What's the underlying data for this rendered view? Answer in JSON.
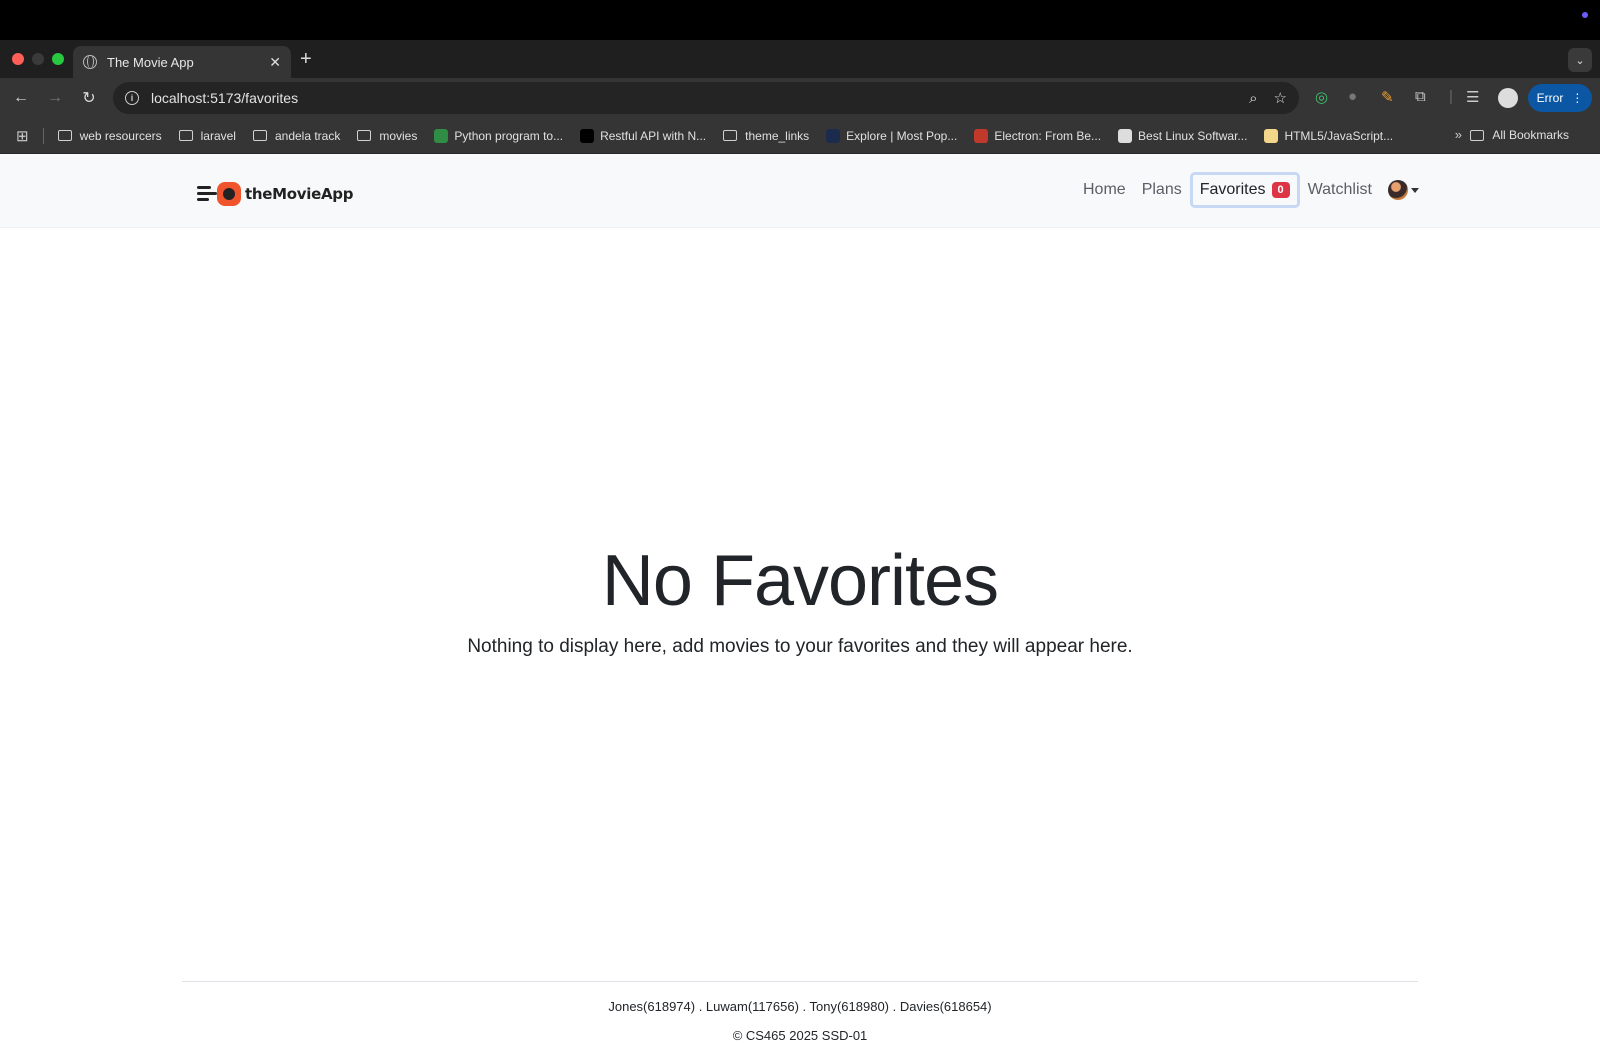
{
  "browser": {
    "tab_title": "The Movie App",
    "new_tab": "+",
    "url": "localhost:5173/favorites",
    "error_label": "Error",
    "bookmarks": [
      {
        "label": "web resourcers",
        "kind": "folder"
      },
      {
        "label": "laravel",
        "kind": "folder"
      },
      {
        "label": "andela track",
        "kind": "folder"
      },
      {
        "label": "movies",
        "kind": "folder"
      },
      {
        "label": "Python program to...",
        "kind": "site",
        "color": "#2f8d46"
      },
      {
        "label": "Restful API with N...",
        "kind": "site",
        "color": "#000000"
      },
      {
        "label": "theme_links",
        "kind": "folder"
      },
      {
        "label": "Explore | Most Pop...",
        "kind": "site",
        "color": "#1a2b4c"
      },
      {
        "label": "Electron: From Be...",
        "kind": "site",
        "color": "#c0392b"
      },
      {
        "label": "Best Linux Softwar...",
        "kind": "site",
        "color": "#dddddd"
      },
      {
        "label": "HTML5/JavaScript...",
        "kind": "site",
        "color": "#f2d78a"
      }
    ],
    "all_bookmarks": "All Bookmarks"
  },
  "app": {
    "logo_text": "theMovieApp",
    "nav": {
      "home": "Home",
      "plans": "Plans",
      "favorites": "Favorites",
      "favorites_count": "0",
      "watchlist": "Watchlist"
    },
    "accent_color": "#dc3545"
  },
  "main": {
    "heading": "No Favorites",
    "lead": "Nothing to display here, add movies to your favorites and they will appear here."
  },
  "footer": {
    "names": "Jones(618974) . Luwam(117656) . Tony(618980) . Davies(618654)",
    "copyright": "© CS465 2025 SSD-01"
  }
}
